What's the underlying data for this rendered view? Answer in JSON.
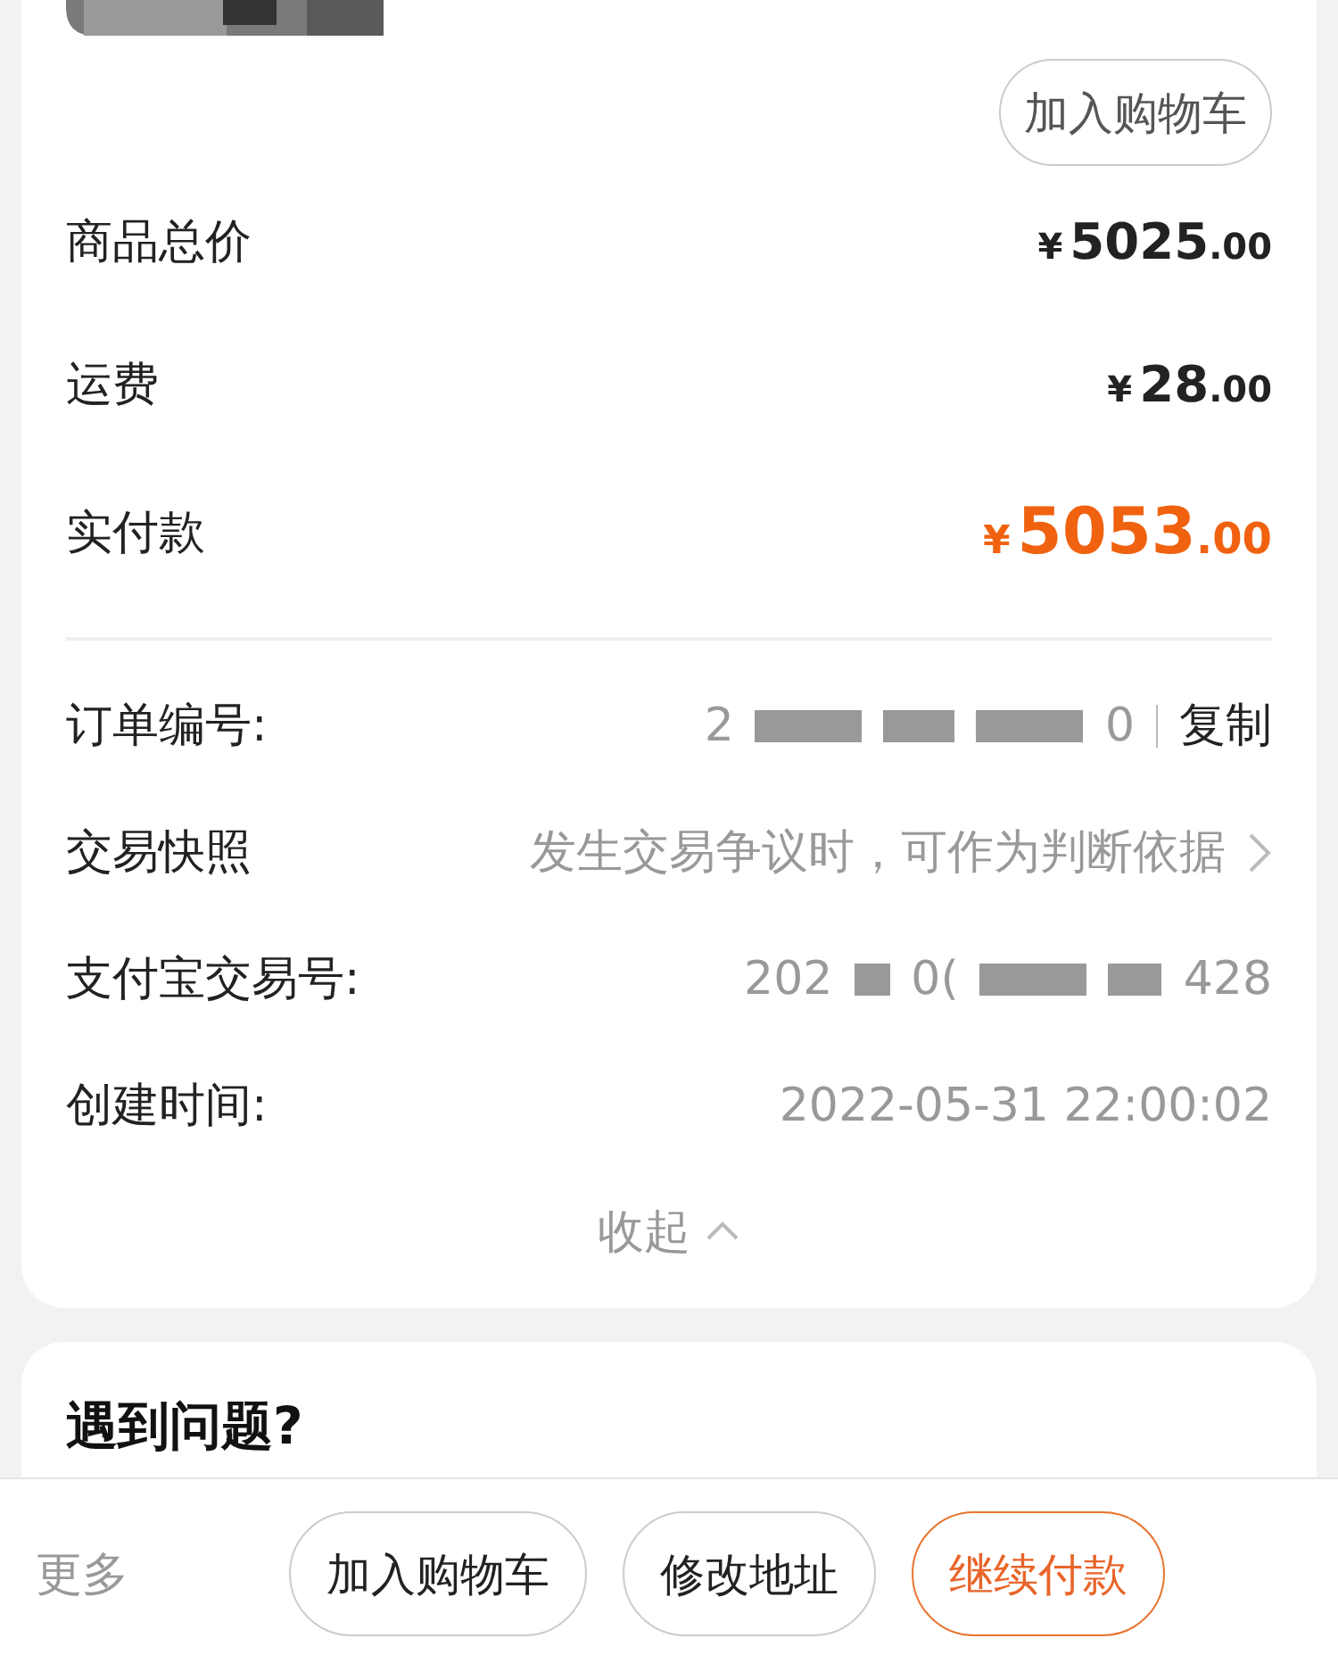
{
  "product": {
    "button": "加入购物车"
  },
  "prices": [
    {
      "label": "商品总价",
      "currency": "¥",
      "integer": "5025",
      "decimal": ".00",
      "emphasis": false
    },
    {
      "label": "运费",
      "currency": "¥",
      "integer": "28",
      "decimal": ".00",
      "emphasis": false
    },
    {
      "label": "实付款",
      "currency": "¥",
      "integer": "5053",
      "decimal": ".00",
      "emphasis": true
    }
  ],
  "details": [
    {
      "kind": "copy",
      "label": "订单编号:",
      "head": "2",
      "tail": "0",
      "action": "复制"
    },
    {
      "kind": "link",
      "label": "交易快照",
      "value": "发生交易争议时，可作为判断依据"
    },
    {
      "kind": "masked",
      "label": "支付宝交易号:",
      "head": "202",
      "middle": "0(",
      "tail": "428"
    },
    {
      "kind": "plain",
      "label": "创建时间:",
      "value": "2022-05-31 22:00:02"
    }
  ],
  "collapse": "收起",
  "help": {
    "title": "遇到问题?"
  },
  "bottom_bar": {
    "more": "更多",
    "buttons": [
      {
        "label": "加入购物车",
        "primary": false
      },
      {
        "label": "修改地址",
        "primary": false
      },
      {
        "label": "继续付款",
        "primary": true
      }
    ]
  }
}
